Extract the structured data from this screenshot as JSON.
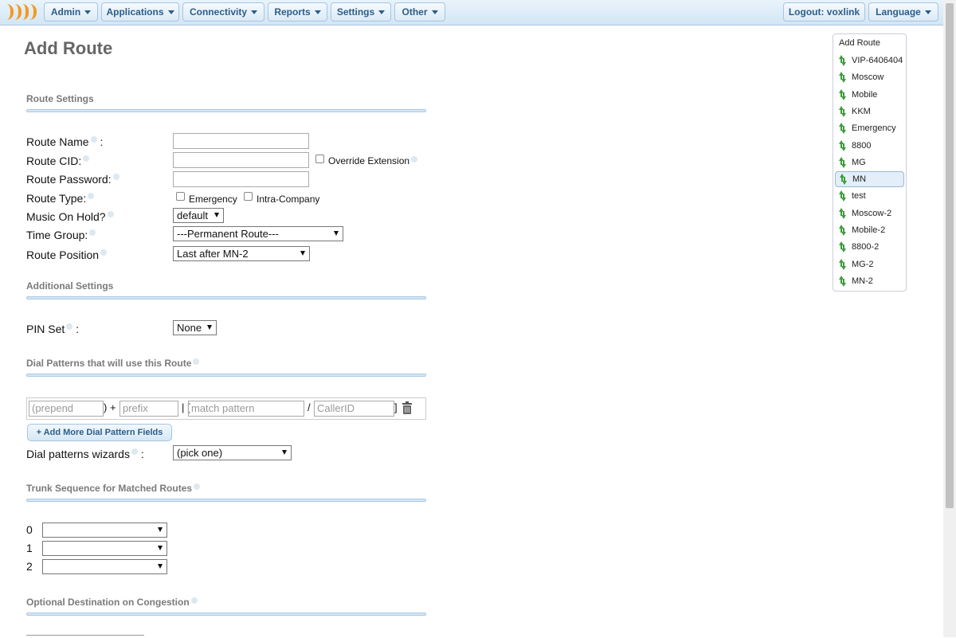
{
  "nav": {
    "menus": [
      "Admin",
      "Applications",
      "Connectivity",
      "Reports",
      "Settings",
      "Other"
    ],
    "logout": "Logout: voxlink",
    "language": "Language"
  },
  "page_title": "Add Route",
  "route_settings": {
    "section_title": "Route Settings",
    "route_name_label": "Route Name",
    "route_name_colon": ":",
    "route_name_value": "",
    "route_cid_label": "Route CID:",
    "route_cid_value": "",
    "override_extension_label": "Override Extension",
    "route_password_label": "Route Password:",
    "route_password_value": "",
    "route_type_label": "Route Type:",
    "emergency_label": "Emergency",
    "intra_company_label": "Intra-Company",
    "music_on_hold_label": "Music On Hold?",
    "music_on_hold_value": "default",
    "time_group_label": "Time Group:",
    "time_group_value": "---Permanent Route---",
    "route_position_label": "Route Position",
    "route_position_value": "Last after MN-2"
  },
  "additional_settings": {
    "section_title": "Additional Settings",
    "pin_set_label": "PIN Set",
    "pin_set_colon": ":",
    "pin_set_value": "None"
  },
  "dial_patterns": {
    "section_title": "Dial Patterns that will use this Route",
    "prepend_placeholder": "(prepend",
    "prefix_placeholder": "prefix",
    "match_placeholder": "match pattern",
    "callerid_placeholder": "CallerID",
    "add_more_label": "+ Add More Dial Pattern Fields",
    "wizards_label": "Dial patterns wizards",
    "wizards_colon": ":",
    "wizards_value": "(pick one)"
  },
  "trunk_sequence": {
    "section_title": "Trunk Sequence for Matched Routes",
    "rows": [
      {
        "index": "0",
        "value": ""
      },
      {
        "index": "1",
        "value": ""
      },
      {
        "index": "2",
        "value": ""
      }
    ]
  },
  "congestion": {
    "section_title": "Optional Destination on Congestion"
  },
  "route_list": {
    "title": "Add Route",
    "items": [
      "VIP-6406404",
      "Moscow",
      "Mobile",
      "KKM",
      "Emergency",
      "8800",
      "MG",
      "MN",
      "test",
      "Moscow-2",
      "Mobile-2",
      "8800-2",
      "MG-2",
      "MN-2"
    ],
    "active": "MN"
  },
  "colors": {
    "accent": "#2c5d8a",
    "logo": "#f39a1e",
    "route_arrow": "#3c9c3c"
  }
}
